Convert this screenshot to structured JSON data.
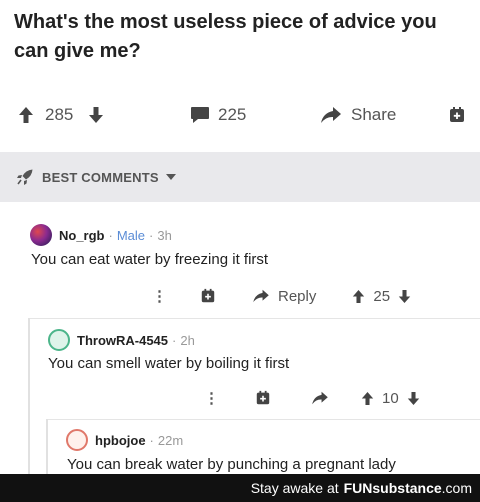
{
  "post": {
    "title": "What's the most useless piece of advice you can give me?",
    "upvotes": "285",
    "comments": "225",
    "share_label": "Share"
  },
  "comments_header": {
    "label": "BEST COMMENTS"
  },
  "comments": [
    {
      "username": "No_rgb",
      "gender": "Male",
      "time": "3h",
      "text": "You can eat water by freezing it first",
      "reply_label": "Reply",
      "score": "25"
    },
    {
      "username": "ThrowRA-4545",
      "time": "2h",
      "text": "You can smell water by boiling it first",
      "score": "10"
    },
    {
      "username": "hpbojoe",
      "time": "22m",
      "text": "You can break water by punching a pregnant lady"
    }
  ],
  "footer": {
    "prefix": "Stay awake at",
    "brand": "FUNsubstance",
    "suffix": ".com"
  }
}
